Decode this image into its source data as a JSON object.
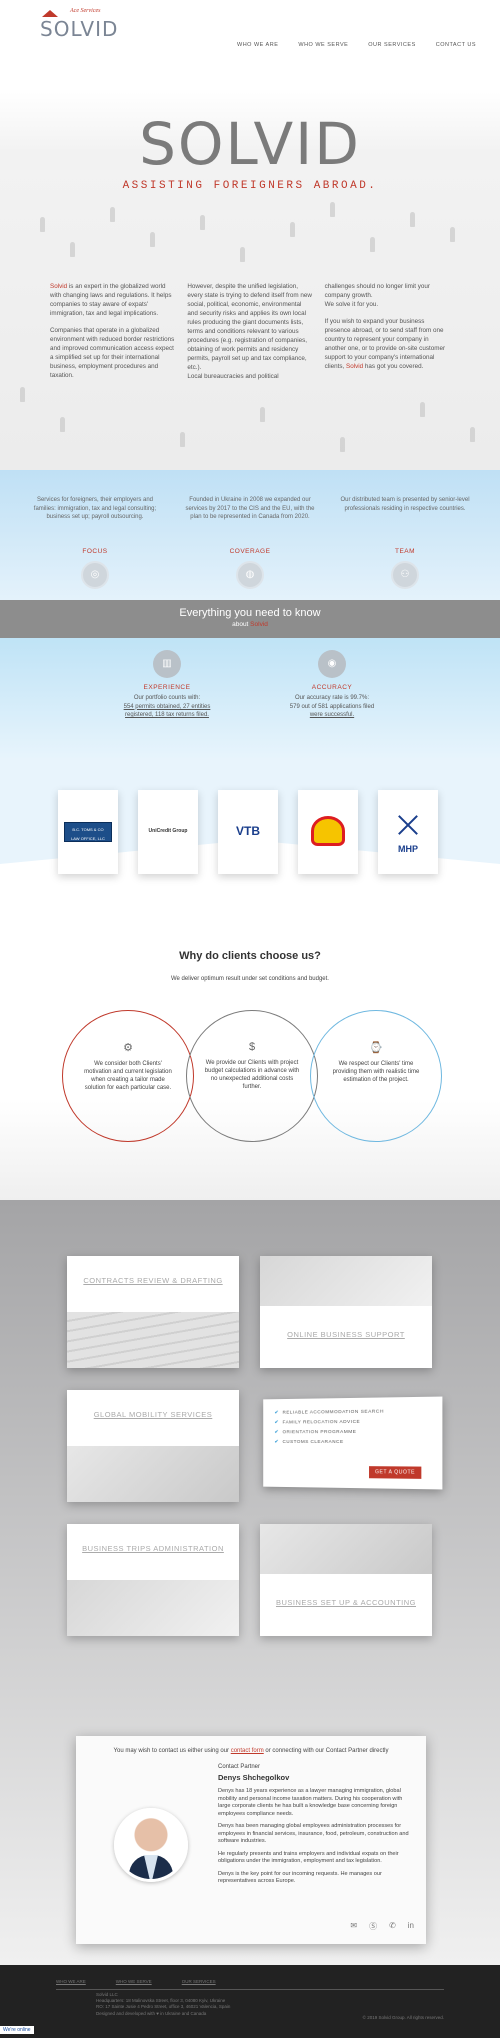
{
  "header": {
    "logo_tagline": "Ace Services",
    "logo_word": "SOLVID",
    "nav": [
      "WHO WE ARE",
      "WHO WE SERVE",
      "OUR SERVICES",
      "CONTACT US"
    ]
  },
  "hero": {
    "title": "SOLVID",
    "subtitle": "ASSISTING FOREIGNERS ABROAD.",
    "col1_brand": "Solvid",
    "col1_p1_rest": " is an expert in the globalized world with changing laws and regulations. It helps companies to stay aware of expats' immigration, tax and legal implications.",
    "col1_p2": "Companies that operate in a globalized environment with reduced border restrictions and improved communication access expect a simplified set up for their international business, employment procedures and taxation.",
    "col2_p1": "However, despite the unified legislation, every state is trying to defend itself from new social, political, economic, environmental and security risks and applies its own local rules producing the giant documents lists, terms and conditions relevant to various procedures (e.g. registration of companies, obtaining of work permits and residency permits, payroll set up and tax compliance, etc.).",
    "col2_p2": "Local bureaucracies and political",
    "col3_p1": "challenges should no longer limit your company growth.",
    "col3_p2": "We solve it for you.",
    "col3_p3_a": "If you wish to expand your business presence abroad, or to send staff from one country to represent your company in another one, or to provide on-site customer support to your company's international clients, ",
    "col3_brand": "Solvid",
    "col3_p3_b": " has got you covered."
  },
  "features": [
    {
      "text": "Services for foreigners, their employers and families: immigration, tax and legal consulting; business set up; payroll outsourcing.",
      "title": "FOCUS",
      "icon": "focus-icon",
      "glyph": "◎"
    },
    {
      "text": "Founded in Ukraine in 2008 we expanded our services by 2017 to the CIS and the EU, with the plan to be represented in Canada from 2020.",
      "title": "COVERAGE",
      "icon": "globe-icon",
      "glyph": "◍"
    },
    {
      "text": "Our distributed team is presented by senior-level professionals residing in respective countries.",
      "title": "TEAM",
      "icon": "team-icon",
      "glyph": "⚇"
    }
  ],
  "band": {
    "title": "Everything you need to know",
    "about": "about ",
    "brand": "Solvid"
  },
  "stats": [
    {
      "title": "EXPERIENCE",
      "icon": "chart-icon",
      "glyph": "▥",
      "line1": "Our portfolio counts with:",
      "line2": "554 permits obtained, 27 entities",
      "line3": "registered, 118 tax returns filed."
    },
    {
      "title": "ACCURACY",
      "icon": "target-icon",
      "glyph": "◉",
      "line1": "Our accuracy rate is 99.7%:",
      "line2": "579 out of 581 applications filed",
      "line3": "were successful."
    }
  ],
  "clients": [
    {
      "name": "B.C. TOMS & CO",
      "sub": "LAW OFFICE, LLC"
    },
    {
      "name": "UniCredit Group"
    },
    {
      "name": "VTB"
    },
    {
      "name": "Shell"
    },
    {
      "name": "MHP"
    }
  ],
  "why": {
    "title": "Why do clients choose us?",
    "subtitle": "We deliver optimum result under set conditions and budget.",
    "circles": [
      {
        "text": "We consider both Clients' motivation and current legislation when creating a tailor made solution for each particular case.",
        "icon": "settings-icon",
        "glyph": "⚙",
        "color": "#c0392b"
      },
      {
        "text": "We provide our Clients with project budget calculations in advance with no unexpected additional costs further.",
        "icon": "money-icon",
        "glyph": "$",
        "color": "#7b7b7b"
      },
      {
        "text": "We respect our Clients' time providing them with realistic time estimation of the project.",
        "icon": "clock-icon",
        "glyph": "⌚",
        "color": "#6fb8e0"
      }
    ]
  },
  "services": {
    "contracts": "CONTRACTS REVIEW & DRAFTING",
    "online": "ONLINE BUSINESS SUPPORT",
    "mobility": "GLOBAL MOBILITY SERVICES",
    "trips": "BUSINESS TRIPS ADMINISTRATION",
    "setup": "BUSINESS SET UP & ACCOUNTING",
    "list": [
      "RELIABLE ACCOMMODATION SEARCH",
      "FAMILY RELOCATION ADVICE",
      "ORIENTATION PROGRAMME",
      "CUSTOMS CLEARANCE"
    ],
    "quote": "GET A QUOTE"
  },
  "contact": {
    "intro_a": "You may wish to contact us either using our ",
    "intro_link": "contact form",
    "intro_b": " or connecting with our Contact Partner directly",
    "role": "Contact Partner",
    "name": "Denys Shchegolkov",
    "bio": [
      "Denys has 18 years experience as a lawyer managing immigration, global mobility and personal income taxation matters. During his cooperation with large corporate clients he has built a knowledge base concerning foreign employees compliance needs.",
      "Denys has been managing global employees administration processes for employees in financial services, insurance, food, petroleum, construction and software industries.",
      "He regularly presents and trains employers and individual expats on their obligations under the immigration, employment and tax legislation.",
      "Denys is the key point for our incoming requests. He manages our representatives across Europe."
    ]
  },
  "footer": {
    "nav": [
      "WHO WE ARE",
      "WHO WE SERVE",
      "OUR SERVICES"
    ],
    "addr1": "Solvid LLC",
    "addr2": "Headquarters: 18 Malinovska Street, floor 3, 04080 Kyiv, Ukraine",
    "addr3": "RO: 17 Sainte Jusie 4 Pedro Street, office 3, 46021 Valencia, Spain",
    "addr4": "Designed and developed with ♥ in Ukraine and Canada",
    "copy": "© 2019 Solvid Group. All rights reserved.",
    "chat": "We're online"
  }
}
